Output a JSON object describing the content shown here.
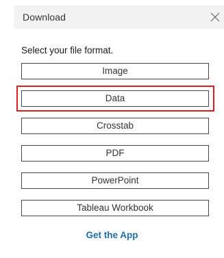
{
  "dialog": {
    "title": "Download",
    "close_icon": "close-icon"
  },
  "instruction": "Select your file format.",
  "formats": [
    {
      "label": "Image"
    },
    {
      "label": "Data",
      "highlighted": true
    },
    {
      "label": "Crosstab"
    },
    {
      "label": "PDF"
    },
    {
      "label": "PowerPoint"
    },
    {
      "label": "Tableau Workbook"
    }
  ],
  "get_app_link": "Get the App",
  "colors": {
    "header_bg": "#f3f3f3",
    "highlight_border": "#e01d1d",
    "link": "#1f6ea8",
    "button_border": "#444444"
  }
}
